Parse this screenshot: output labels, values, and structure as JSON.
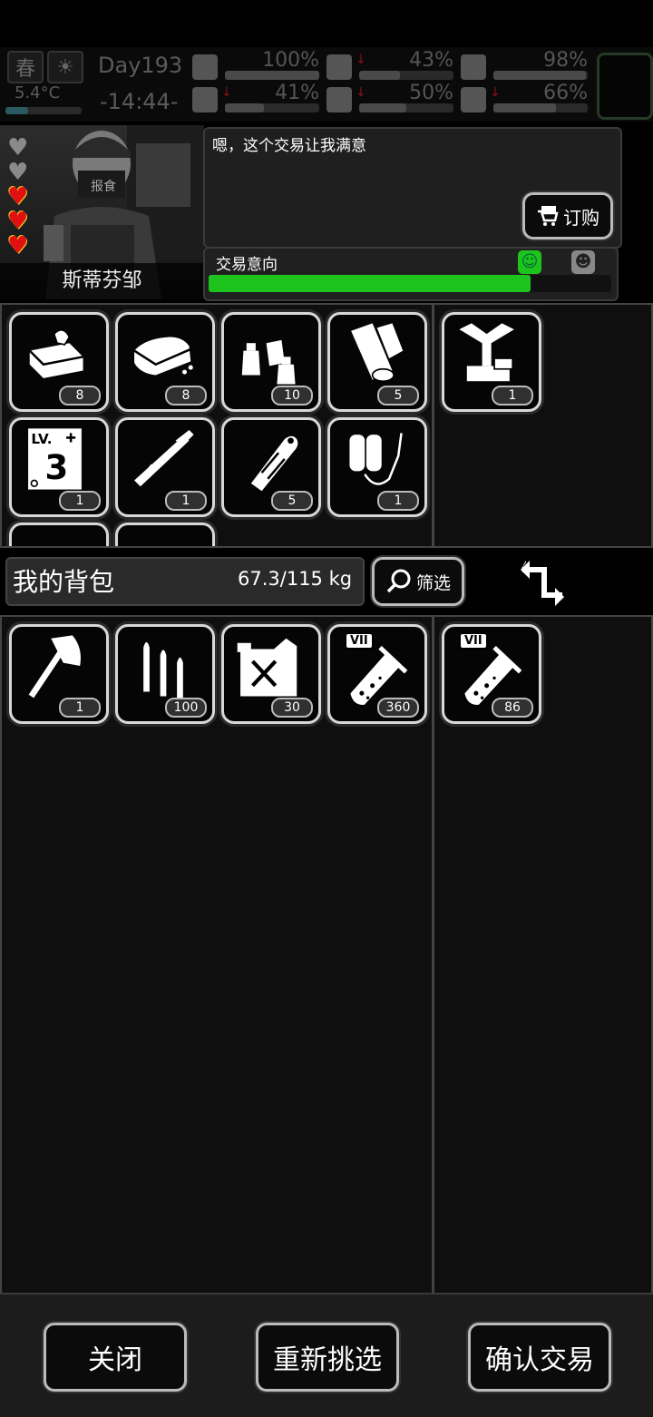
{
  "status": {
    "season": "春",
    "day": "Day193",
    "temperature": "5.4°C",
    "time": "-14:44-",
    "stats": [
      {
        "icon": "medkit-icon",
        "value": "100%",
        "level": 1.0,
        "down": false
      },
      {
        "icon": "stomach-icon",
        "value": "43%",
        "level": 0.43,
        "down": true
      },
      {
        "icon": "stamina-icon",
        "value": "98%",
        "level": 0.98,
        "down": false
      },
      {
        "icon": "boot-icon",
        "value": "41%",
        "level": 0.41,
        "down": true
      },
      {
        "icon": "water-drop-icon",
        "value": "50%",
        "level": 0.5,
        "down": true
      },
      {
        "icon": "heart-icon",
        "value": "66%",
        "level": 0.66,
        "down": true
      }
    ]
  },
  "trader": {
    "name": "斯蒂芬邹",
    "mask_text": "报食",
    "hearts": [
      false,
      false,
      true,
      true,
      true
    ],
    "dialogue": "嗯，这个交易让我满意",
    "order_label": "订购",
    "intent_label": "交易意向",
    "intent_level": 0.8,
    "colors": {
      "intent_fill": "#1ec41e"
    }
  },
  "trader_items": [
    {
      "icon": "canned-food-icon",
      "qty": "8"
    },
    {
      "icon": "bread-icon",
      "qty": "8"
    },
    {
      "icon": "seasoning-bottles-icon",
      "qty": "10"
    },
    {
      "icon": "cloth-rolls-icon",
      "qty": "5"
    },
    {
      "icon": "skill-book-icon",
      "qty": "1",
      "book_level": "3",
      "book_label": "LV."
    },
    {
      "icon": "rpg-launcher-icon",
      "qty": "1"
    },
    {
      "icon": "grenade-icon",
      "qty": "5"
    },
    {
      "icon": "oxygen-tank-icon",
      "qty": "1"
    }
  ],
  "trader_offer": [
    {
      "icon": "workbench-icon",
      "qty": "1"
    }
  ],
  "bag": {
    "title": "我的背包",
    "weight": "67.3/115 kg",
    "filter_label": "筛选"
  },
  "bag_items": [
    {
      "icon": "axe-icon",
      "qty": "1"
    },
    {
      "icon": "ammo-icon",
      "qty": "100"
    },
    {
      "icon": "fuel-can-icon",
      "qty": "30"
    },
    {
      "icon": "test-tube-icon",
      "qty": "360",
      "tag": "VII"
    }
  ],
  "bag_offer": [
    {
      "icon": "test-tube-icon",
      "qty": "86",
      "tag": "VII"
    }
  ],
  "buttons": {
    "close": "关闭",
    "reselect": "重新挑选",
    "confirm": "确认交易"
  }
}
